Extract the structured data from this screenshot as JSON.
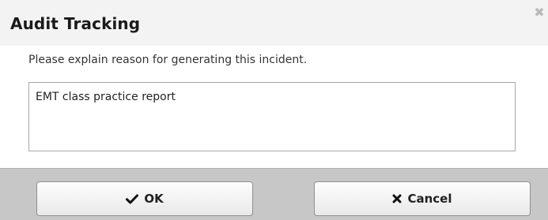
{
  "dialog": {
    "title": "Audit Tracking",
    "close_icon": "close-icon",
    "prompt": "Please explain reason for generating this incident.",
    "reason_value": "EMT class practice report"
  },
  "buttons": {
    "ok_label": "OK",
    "ok_icon": "check-icon",
    "cancel_label": "Cancel",
    "cancel_icon": "x-icon"
  }
}
